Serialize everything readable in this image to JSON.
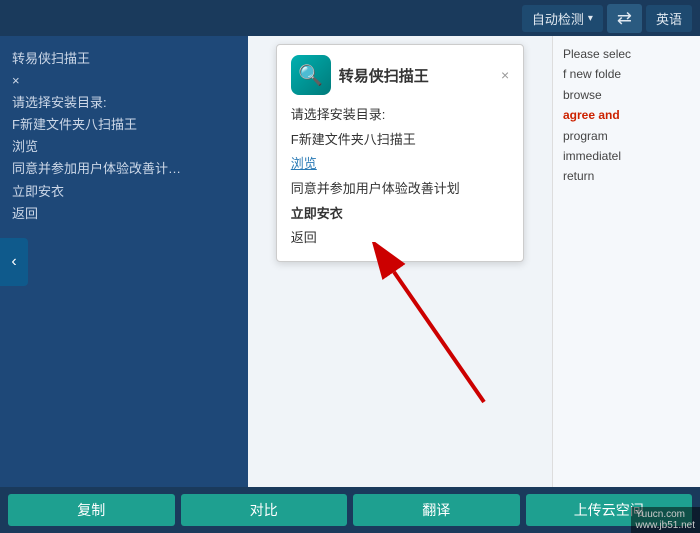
{
  "topbar": {
    "auto_detect_label": "自动检测",
    "swap_icon": "⇄",
    "lang_label": "英语"
  },
  "left_panel": {
    "lines": [
      "转易侠扫描王",
      "×",
      "请选择安装目录:",
      "F新建文件夹八扫描王",
      "浏览",
      "同意并参加用户体验改善计划",
      "立即安衣",
      "返回"
    ]
  },
  "middle_panel": {
    "installer": {
      "title": "转易侠扫描王",
      "close": "×",
      "lines": [
        {
          "text": "请选择安装目录:",
          "type": "normal"
        },
        {
          "text": "F新建文件夹八扫描王",
          "type": "normal"
        },
        {
          "text": "浏览",
          "type": "link"
        },
        {
          "text": "同意并参加用户体验改善计划",
          "type": "normal"
        },
        {
          "text": "立即安衣",
          "type": "bold"
        },
        {
          "text": "返回",
          "type": "normal"
        }
      ]
    }
  },
  "right_panel": {
    "lines": [
      "Please selec",
      "f new folde",
      "browse",
      "agree and",
      "program",
      "immediatel",
      "return"
    ]
  },
  "toolbar": {
    "buttons": [
      {
        "label": "复制",
        "name": "copy-button"
      },
      {
        "label": "对比",
        "name": "compare-button"
      },
      {
        "label": "翻译",
        "name": "translate-button"
      },
      {
        "label": "上传云空间",
        "name": "upload-button"
      }
    ]
  },
  "watermark": {
    "line1": "Yuucn.com",
    "line2": "www.jb51.net"
  }
}
